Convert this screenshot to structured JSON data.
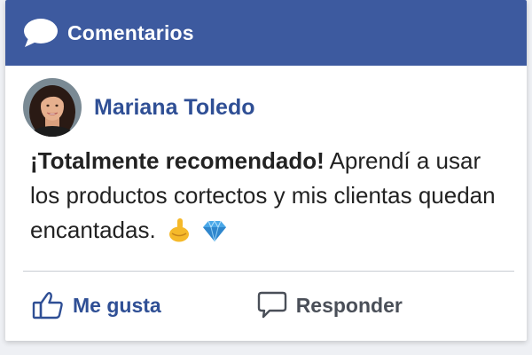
{
  "header": {
    "title": "Comentarios",
    "icon": "speech-bubble-icon"
  },
  "comment": {
    "author": "Mariana Toledo",
    "text_bold": "¡Totalmente recomendado!",
    "text": " Aprendí a usar los productos cortectos y mis clientas quedan encantadas.",
    "emojis": [
      "ok-hand-emoji",
      "gem-emoji"
    ]
  },
  "actions": {
    "like_label": "Me gusta",
    "like_icon": "thumbs-up-icon",
    "reply_label": "Responder",
    "reply_icon": "comment-bubble-icon"
  },
  "colors": {
    "header_bg": "#3d5a9f",
    "accent": "#2f4f95"
  }
}
